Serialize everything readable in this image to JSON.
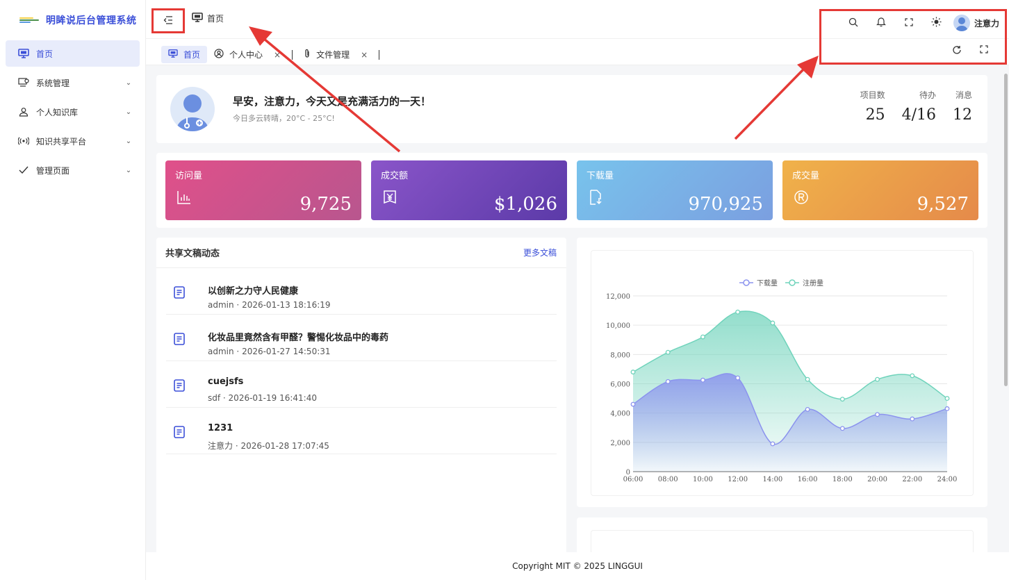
{
  "app": {
    "title": "明眸说后台管理系统"
  },
  "sidebar": {
    "items": [
      {
        "label": "首页",
        "icon": "monitor-icon",
        "active": true
      },
      {
        "label": "系统管理",
        "icon": "settings-computer-icon",
        "expandable": true
      },
      {
        "label": "个人知识库",
        "icon": "user-icon",
        "expandable": true
      },
      {
        "label": "知识共享平台",
        "icon": "broadcast-icon",
        "expandable": true
      },
      {
        "label": "管理页面",
        "icon": "check-icon",
        "expandable": true
      }
    ]
  },
  "topbar": {
    "breadcrumb": "首页",
    "username": "注意力",
    "icons": [
      "search-icon",
      "bell-icon",
      "fullscreen-icon",
      "theme-sun-icon"
    ]
  },
  "tabs": [
    {
      "label": "首页",
      "icon": "monitor-icon",
      "active": true
    },
    {
      "label": "个人中心",
      "icon": "user-circle-icon",
      "closable": true
    },
    {
      "label": "文件管理",
      "icon": "paperclip-icon",
      "closable": true
    }
  ],
  "welcome": {
    "greeting": "早安，注意力，今天又是充满活力的一天！",
    "weather": "今日多云转晴，20°C - 25°C!",
    "stats": [
      {
        "label": "项目数",
        "value": "25"
      },
      {
        "label": "待办",
        "value": "4/16"
      },
      {
        "label": "消息",
        "value": "12"
      }
    ]
  },
  "metrics": [
    {
      "title": "访问量",
      "value": "9,725",
      "icon": "bar-chart-icon",
      "color_from": "#e0508a",
      "color_to": "#b8568e"
    },
    {
      "title": "成交额",
      "value": "$1,026",
      "icon": "yen-icon",
      "color_from": "#8a55c9",
      "color_to": "#5b3aa8"
    },
    {
      "title": "下载量",
      "value": "970,925",
      "icon": "download-file-icon",
      "color_from": "#78c3ec",
      "color_to": "#7b9fe0"
    },
    {
      "title": "成交量",
      "value": "9,527",
      "icon": "registered-icon",
      "color_from": "#f0b24a",
      "color_to": "#e58a4a"
    }
  ],
  "feed": {
    "title": "共享文稿动态",
    "more": "更多文稿",
    "items": [
      {
        "title": "以创新之力守人民健康",
        "author": "admin",
        "time": "2026-01-13 18:16:19"
      },
      {
        "title": "化妆品里竟然含有甲醛？警惕化妆品中的毒药",
        "author": "admin",
        "time": "2026-01-27 14:50:31"
      },
      {
        "title": "cuejsfs",
        "author": "sdf",
        "time": "2026-01-19 16:41:40"
      },
      {
        "title": "1231",
        "author": "注意力",
        "time": "2026-01-28 17:07:45"
      }
    ]
  },
  "footer": {
    "text": "Copyright MIT © 2025 LINGGUI"
  },
  "chart_data": {
    "type": "area",
    "x": [
      "06:00",
      "08:00",
      "10:00",
      "12:00",
      "14:00",
      "16:00",
      "18:00",
      "20:00",
      "22:00",
      "24:00"
    ],
    "ylim": [
      0,
      12000
    ],
    "yticks": [
      "0",
      "2,000",
      "4,000",
      "6,000",
      "8,000",
      "10,000",
      "12,000"
    ],
    "legend_position": "top-center",
    "grid": true,
    "series": [
      {
        "name": "下载量",
        "color": "#8b93ee",
        "values": [
          4600,
          6150,
          6250,
          6400,
          1900,
          4250,
          2950,
          3900,
          3600,
          4300
        ]
      },
      {
        "name": "注册量",
        "color": "#6fd3bb",
        "values": [
          6800,
          8150,
          9200,
          10900,
          10150,
          6300,
          4950,
          6300,
          6550,
          5000
        ]
      }
    ]
  }
}
